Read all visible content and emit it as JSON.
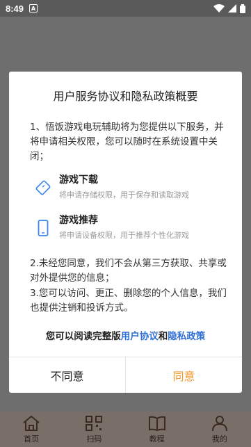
{
  "status_bar": {
    "time": "8:49",
    "app_icon_letter": "A"
  },
  "dialog": {
    "title": "用户服务协议和隐私政策概要",
    "intro": "1、悟饭游戏电玩辅助将为您提供以下服务，并将申请相关权限，您可以随时在系统设置中关闭；",
    "permissions": [
      {
        "name": "游戏下载",
        "desc": "将申请存储权限，用于保存和读取游戏",
        "icon": "storage-icon"
      },
      {
        "name": "游戏推荐",
        "desc": "将申请设备权限，用于推荐个性化游戏",
        "icon": "phone-icon"
      }
    ],
    "para2": "2.未经您同意，我们不会从第三方获取、共享或对外提供您的信息；",
    "para3": "3.您可以访问、更正、删除您的个人信息，我们也提供注销和投诉方式。",
    "read_prefix": "您可以阅读完整版",
    "user_agreement_link": "用户协议",
    "and_text": "和",
    "privacy_link": "隐私政策",
    "disagree_label": "不同意",
    "agree_label": "同意"
  },
  "bottom_nav": [
    {
      "label": "首页",
      "icon": "home-icon"
    },
    {
      "label": "扫码",
      "icon": "qr-code-icon"
    },
    {
      "label": "教程",
      "icon": "book-icon"
    },
    {
      "label": "我的",
      "icon": "person-icon"
    }
  ],
  "colors": {
    "link": "#2f6fd6",
    "agree": "#f2992e",
    "icon_blue": "#3b86f0"
  }
}
